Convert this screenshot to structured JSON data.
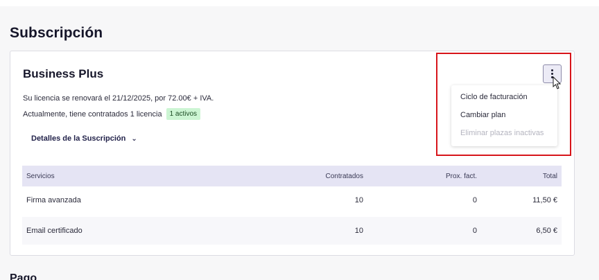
{
  "page": {
    "title": "Subscripción",
    "next_section": "Pago"
  },
  "subscription": {
    "plan_name": "Business Plus",
    "renewal_text": "Su licencia se renovará el 21/12/2025, por 72.00€ + IVA.",
    "licenses_text": "Actualmente, tiene contratados 1 licencia",
    "active_badge": "1 activos",
    "details_label": "Detalles de la Suscripción"
  },
  "table": {
    "headers": [
      "Servicios",
      "Contratados",
      "Prox. fact.",
      "Total"
    ],
    "rows": [
      {
        "service": "Firma avanzada",
        "contracted": "10",
        "next": "0",
        "total": "11,50 €"
      },
      {
        "service": "Email certificado",
        "contracted": "10",
        "next": "0",
        "total": "6,50 €"
      }
    ]
  },
  "menu": {
    "button_icon": "kebab-vertical-icon",
    "items": [
      {
        "label": "Ciclo de facturación",
        "disabled": false
      },
      {
        "label": "Cambiar plan",
        "disabled": false
      },
      {
        "label": "Eliminar plazas inactivas",
        "disabled": true
      }
    ]
  },
  "colors": {
    "accent": "#22224a",
    "highlight_border": "#d7141a",
    "badge_bg": "#ccf5d3",
    "table_header_bg": "#e5e4f4"
  }
}
